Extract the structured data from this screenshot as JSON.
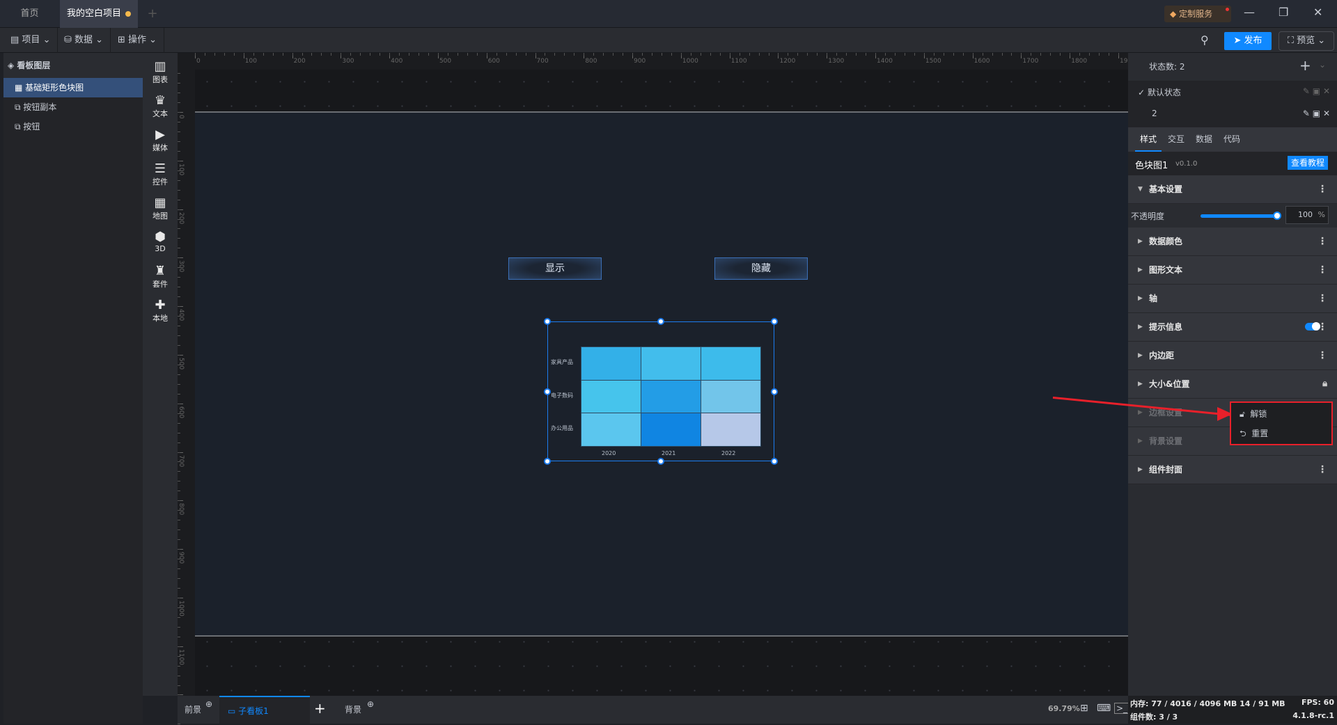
{
  "tabs": [
    {
      "label": "首页"
    },
    {
      "label": "我的空白项目"
    }
  ],
  "topbar": {
    "custom_service": "定制服务"
  },
  "toolbar": {
    "project": "项目",
    "data": "数据",
    "operate": "操作",
    "publish": "发布",
    "preview": "预览"
  },
  "layers": {
    "title": "看板图层",
    "items": [
      {
        "label": "基础矩形色块图"
      },
      {
        "label": "按钮副本"
      },
      {
        "label": "按钮"
      }
    ]
  },
  "components": [
    {
      "label": "图表",
      "glyph": "▥"
    },
    {
      "label": "文本",
      "glyph": "♛"
    },
    {
      "label": "媒体",
      "glyph": "▶"
    },
    {
      "label": "控件",
      "glyph": "☰"
    },
    {
      "label": "地图",
      "glyph": "▦"
    },
    {
      "label": "3D",
      "glyph": "⬢"
    },
    {
      "label": "套件",
      "glyph": "♜"
    },
    {
      "label": "本地",
      "glyph": "✚"
    }
  ],
  "canvas": {
    "show_button": "显示",
    "hide_button": "隐藏"
  },
  "chart_data": {
    "type": "heatmap",
    "x_categories": [
      "2020",
      "2021",
      "2022"
    ],
    "y_categories": [
      "家具产品",
      "电子数码",
      "办公用品"
    ],
    "colors": [
      [
        "#33b0e8",
        "#42bdec",
        "#3dbbeb"
      ],
      [
        "#46c4ec",
        "#239de6",
        "#72c5ea"
      ],
      [
        "#5bc6ee",
        "#1085e2",
        "#b6c8e8"
      ]
    ]
  },
  "right": {
    "state_count": "状态数: 2",
    "states": [
      {
        "label": "默认状态"
      },
      {
        "label": "2"
      }
    ],
    "tabs": [
      "样式",
      "交互",
      "数据",
      "代码"
    ],
    "component_name": "色块图1",
    "version": "v0.1.0",
    "tutorial": "查看教程",
    "basic": "基本设置",
    "opacity_label": "不透明度",
    "opacity_value": "100",
    "opacity_unit": "%",
    "opacity_fraction": 1.0,
    "sections": [
      "数据颜色",
      "图形文本",
      "轴",
      "提示信息",
      "内边距",
      "大小&位置",
      "边框设置",
      "背景设置",
      "组件封面"
    ],
    "menu": {
      "unlock": "解锁",
      "reset": "重置"
    }
  },
  "bottom": {
    "foreground": "前景",
    "board": "子看板1",
    "background": "背景",
    "zoom": "69.79%"
  },
  "status": {
    "memory": "内存: 77 / 4016 / 4096 MB  14 / 91 MB",
    "fps": "FPS:  60",
    "count": "组件数: 3 / 3",
    "version": "4.1.8-rc.1"
  },
  "accent": "#1089ff"
}
